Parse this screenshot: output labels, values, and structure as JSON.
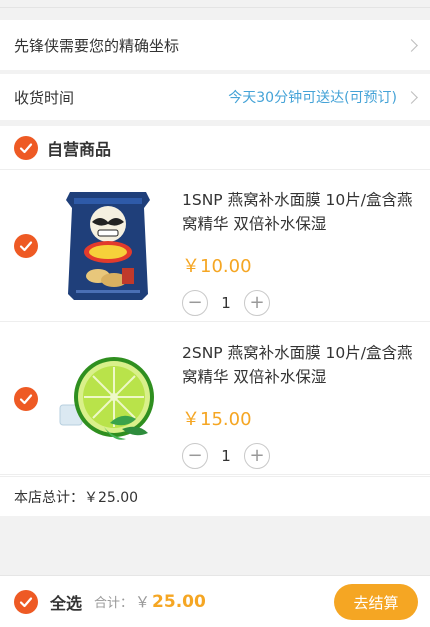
{
  "address": {
    "label": "先锋侠需要您的精确坐标"
  },
  "delivery": {
    "label": "收货时间",
    "value": "今天30分钟可送达(可预订)"
  },
  "store": {
    "title": "自营商品",
    "items": [
      {
        "title": "1SNP 燕窝补水面膜 10片/盒含燕窝精华 双倍补水保湿",
        "price": "￥10.00",
        "qty": "1",
        "image": "chips-bag",
        "minus": "−",
        "plus": "+"
      },
      {
        "title": "2SNP 燕窝补水面膜 10片/盒含燕窝精华 双倍补水保湿",
        "price": "￥15.00",
        "qty": "1",
        "image": "lime-slice",
        "minus": "−",
        "plus": "+"
      }
    ],
    "total_text": "本店总计：￥25.00"
  },
  "footer": {
    "select_all": "全选",
    "total_label": "合计：",
    "currency": "￥",
    "total_value": "25.00",
    "checkout": "去结算"
  },
  "colors": {
    "accent_red": "#ee5a24",
    "price_orange": "#f5a623",
    "link_blue": "#45a3d7"
  }
}
